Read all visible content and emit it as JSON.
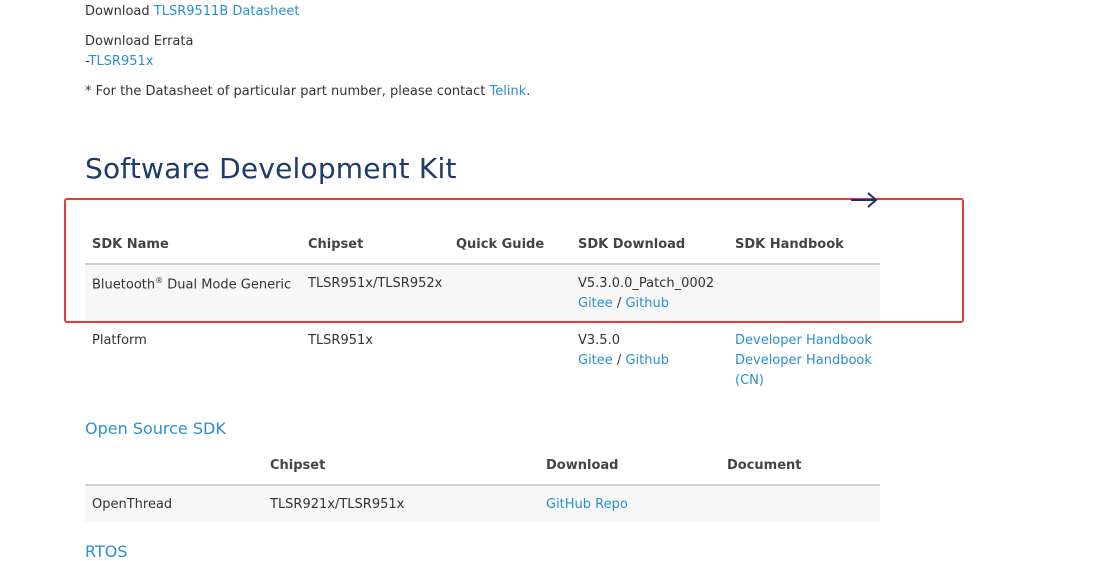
{
  "downloads": {
    "datasheet_prefix": "Download ",
    "datasheet_link": "TLSR9511B Datasheet",
    "errata_label": "Download Errata",
    "errata_dash": "-",
    "errata_link": "TLSR951x",
    "note_prefix": "* For the Datasheet of particular part number, please contact ",
    "note_link": "Telink",
    "note_suffix": "."
  },
  "sdk_section": {
    "title": "Software Development Kit",
    "headers": [
      "SDK Name",
      "Chipset",
      "Quick Guide",
      "SDK Download",
      "SDK Handbook"
    ],
    "rows": [
      {
        "name_main": "Bluetooth",
        "name_sup": "®",
        "name_rest": " Dual Mode Generic",
        "chipset": "TLSR951x/TLSR952x",
        "quick_guide": "",
        "version": "V5.3.0.0_Patch_0002",
        "gitee": "Gitee",
        "sep": " / ",
        "github": "Github",
        "handbook1": "",
        "handbook2": "",
        "handbook3": ""
      },
      {
        "name_main": "Platform",
        "name_sup": "",
        "name_rest": "",
        "chipset": "TLSR951x",
        "quick_guide": "",
        "version": "V3.5.0",
        "gitee": "Gitee",
        "sep": " / ",
        "github": "Github",
        "handbook1": "Developer Handbook",
        "handbook2": "Developer Handbook",
        "handbook3": "(CN)"
      }
    ]
  },
  "open_source": {
    "title": "Open Source SDK",
    "headers": [
      "",
      "Chipset",
      "Download",
      "Document"
    ],
    "rows": [
      {
        "name": "OpenThread",
        "chipset": "TLSR921x/TLSR951x",
        "download": "GitHub Repo",
        "document": ""
      }
    ]
  },
  "rtos": {
    "title": "RTOS"
  },
  "annotation": {
    "color": "#e63a3a",
    "arrow_icon": "right-arrow-icon"
  }
}
